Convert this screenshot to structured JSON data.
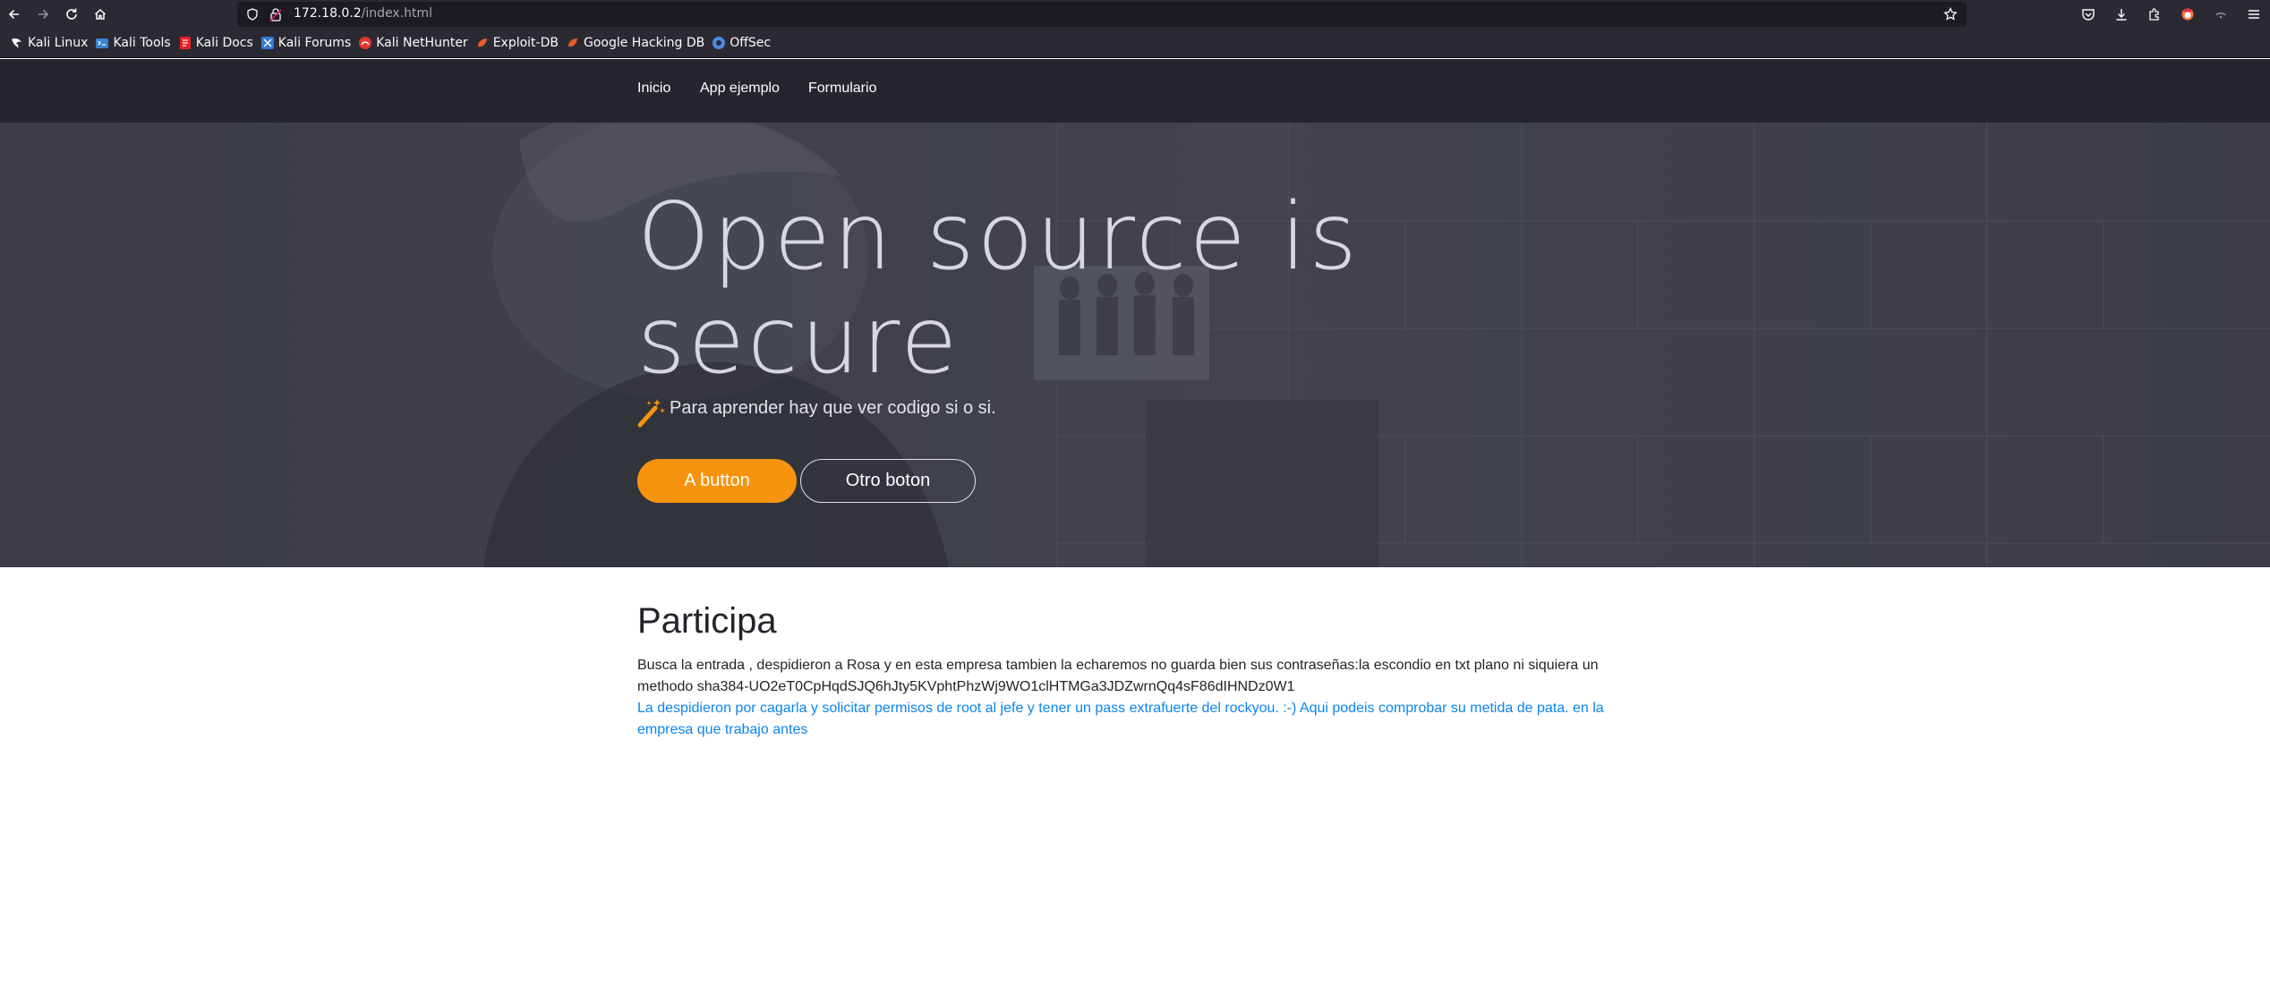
{
  "browser": {
    "url_host": "172.18.0.2",
    "url_path": "/index.html",
    "bookmarks": [
      {
        "label": "Kali Linux",
        "icon": "kali-dragon-icon",
        "color": "#3d83d6"
      },
      {
        "label": "Kali Tools",
        "icon": "kali-tools-icon",
        "color": "#ffffff"
      },
      {
        "label": "Kali Docs",
        "icon": "kali-docs-icon",
        "color": "#e62228"
      },
      {
        "label": "Kali Forums",
        "icon": "kali-forums-icon",
        "color": "#2f7ad6"
      },
      {
        "label": "Kali NetHunter",
        "icon": "nethunter-icon",
        "color": "#e0362d"
      },
      {
        "label": "Exploit-DB",
        "icon": "exploit-db-icon",
        "color": "#ea5a2c"
      },
      {
        "label": "Google Hacking DB",
        "icon": "ghdb-icon",
        "color": "#ea5a2c"
      },
      {
        "label": "OffSec",
        "icon": "offsec-icon",
        "color": "#4c8be0"
      }
    ]
  },
  "nav": {
    "items": [
      "Inicio",
      "App ejemplo",
      "Formulario"
    ]
  },
  "hero": {
    "title": "Open source is secure",
    "subtitle": "Para aprender hay que ver codigo si o si.",
    "primary_button": "A button",
    "secondary_button": "Otro boton",
    "accent_color": "#f7930d"
  },
  "content": {
    "heading": "Participa",
    "paragraph": "Busca la entrada , despidieron a Rosa y en esta empresa tambien la echaremos no guarda bien sus contraseñas:la escondio en txt plano ni siquiera un methodo sha384-UO2eT0CpHqdSJQ6hJty5KVphtPhzWj9WO1clHTMGa3JDZwrnQq4sF86dIHNDz0W1",
    "link": "La despidieron por cagarla y solicitar permisos de root al jefe y tener un pass extrafuerte del rockyou. :-) Aqui podeis comprobar su metida de pata. en la empresa que trabajo antes",
    "link_color": "#0b84ef"
  }
}
